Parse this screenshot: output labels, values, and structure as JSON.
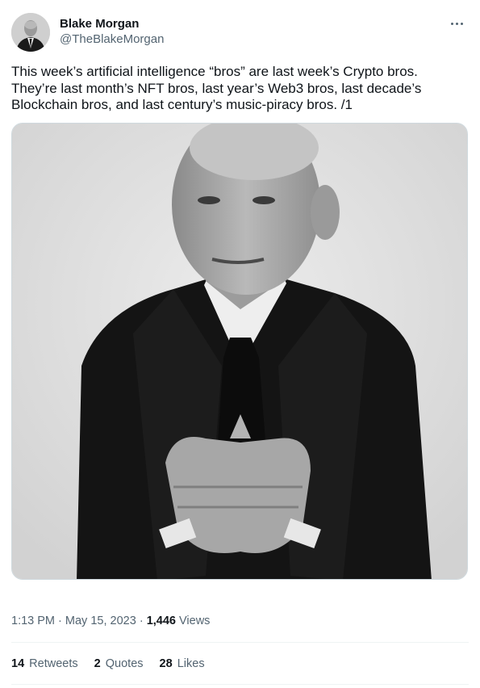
{
  "author": {
    "display_name": "Blake Morgan",
    "handle": "@TheBlakeMorgan"
  },
  "tweet": {
    "text": "This week’s artificial intelligence “bros” are last week’s Crypto bros.\nThey’re last month’s NFT bros, last year’s Web3 bros, last decade’s\nBlockchain bros, and last century’s music-piracy bros. /1",
    "time": "1:13 PM",
    "separator": "·",
    "date": "May 15, 2023",
    "views_count": "1,446",
    "views_label": "Views"
  },
  "stats": {
    "retweets_count": "14",
    "retweets_label": "Retweets",
    "quotes_count": "2",
    "quotes_label": "Quotes",
    "likes_count": "28",
    "likes_label": "Likes"
  },
  "icons": {
    "more": "more-horizontal-icon"
  },
  "colors": {
    "text_primary": "#0f1419",
    "text_secondary": "#536471",
    "divider": "#eff3f4"
  }
}
